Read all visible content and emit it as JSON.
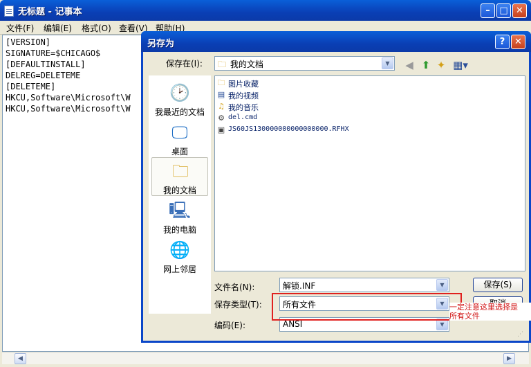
{
  "notepad": {
    "title": "无标题 - 记事本",
    "menu": [
      "文件(F)",
      "编辑(E)",
      "格式(O)",
      "查看(V)",
      "帮助(H)"
    ],
    "content_lines": [
      "[VERSION]",
      "SIGNATURE=$CHICAGO$",
      "[DEFAULTINSTALL]",
      "DELREG=DELETEME",
      "[DELETEME]",
      "HKCU,Software\\Microsoft\\W",
      "HKCU,Software\\Microsoft\\W"
    ]
  },
  "dialog": {
    "title": "另存为",
    "help_label": "?",
    "close_label": "✕",
    "save_in_label": "保存在(I):",
    "save_in_value": "我的文档",
    "places": [
      {
        "label": "我最近的文档",
        "icon": "recent-documents-icon"
      },
      {
        "label": "桌面",
        "icon": "desktop-icon"
      },
      {
        "label": "我的文档",
        "icon": "my-documents-icon"
      },
      {
        "label": "我的电脑",
        "icon": "my-computer-icon"
      },
      {
        "label": "网上邻居",
        "icon": "network-places-icon"
      }
    ],
    "files": [
      {
        "name": "图片收藏",
        "icon": "pictures-folder-icon"
      },
      {
        "name": "我的视频",
        "icon": "videos-folder-icon"
      },
      {
        "name": "我的音乐",
        "icon": "music-folder-icon"
      },
      {
        "name": "del.cmd",
        "icon": "cmd-file-icon"
      },
      {
        "name": "JS60JS130000000000000000.RFHX",
        "icon": "rfhx-file-icon"
      }
    ],
    "filename_label": "文件名(N):",
    "filename_value": "解锁.INF",
    "filetype_label": "保存类型(T):",
    "filetype_value": "所有文件",
    "encoding_label": "编码(E):",
    "encoding_value": "ANSI",
    "save_button": "保存(S)",
    "cancel_button": "取消"
  },
  "annotation": {
    "line1": "一定注意这里选择是",
    "line2": "所有文件",
    "color": "#e0211f"
  },
  "colors": {
    "titlebar": "#0a46c8",
    "face": "#ece9d8"
  }
}
